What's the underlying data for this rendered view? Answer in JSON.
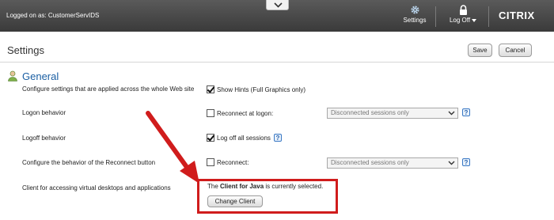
{
  "topbar": {
    "logged_on": "Logged on as: CustomerServIDS",
    "settings_label": "Settings",
    "logoff_label": "Log Off",
    "logo": "CITRIX",
    "collapse_icon": "chevron-down-icon"
  },
  "page": {
    "title": "Settings",
    "save_label": "Save",
    "cancel_label": "Cancel"
  },
  "section": {
    "title": "General",
    "icon": "user-icon"
  },
  "rows": {
    "hints": {
      "label": "Configure settings that are applied across the whole Web site",
      "option": "Show Hints (Full Graphics only)",
      "checked": true
    },
    "logon": {
      "label": "Logon behavior",
      "option": "Reconnect at logon:",
      "checked": false,
      "select_value": "Disconnected sessions only"
    },
    "logoff": {
      "label": "Logoff behavior",
      "option": "Log off all sessions",
      "checked": true
    },
    "reconnect": {
      "label": "Configure the behavior of the Reconnect button",
      "option": "Reconnect:",
      "checked": false,
      "select_value": "Disconnected sessions only"
    },
    "client": {
      "label": "Client for accessing virtual desktops and applications",
      "text_prefix": "The ",
      "text_bold": "Client for Java",
      "text_suffix": " is currently selected.",
      "button": "Change Client"
    }
  },
  "help_glyph": "?",
  "colors": {
    "accent": "#1b5fa3",
    "annotation_red": "#d01c1c",
    "topbar": "#3a3a3a"
  }
}
